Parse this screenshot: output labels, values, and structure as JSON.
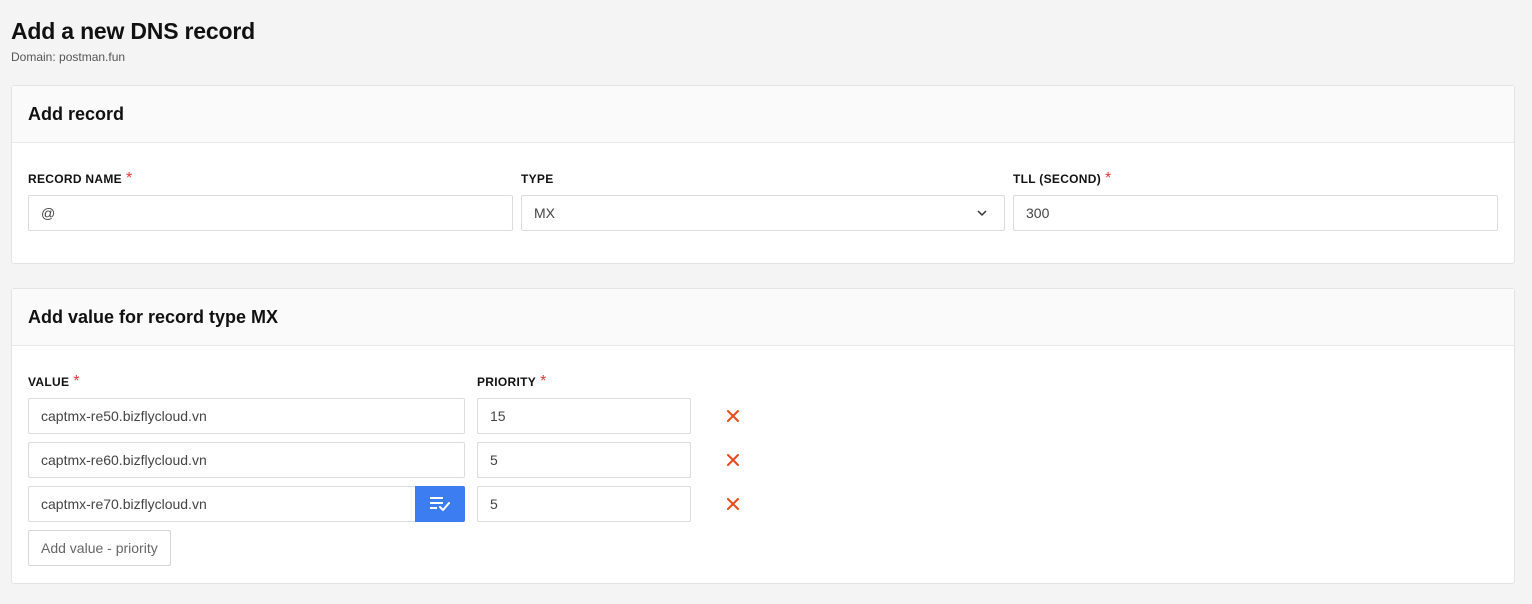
{
  "header": {
    "title": "Add a new DNS record",
    "subtitle": "Domain: postman.fun"
  },
  "record_card": {
    "title": "Add record",
    "name_label": "RECORD NAME",
    "name_value": "@",
    "type_label": "TYPE",
    "type_value": "MX",
    "ttl_label": "TLL (SECOND)",
    "ttl_value": "300",
    "required_mark": "*"
  },
  "value_card": {
    "title": "Add value for record type MX",
    "value_label": "VALUE",
    "priority_label": "PRIORITY",
    "rows": [
      {
        "value": "captmx-re50.bizflycloud.vn",
        "priority": "15"
      },
      {
        "value": "captmx-re60.bizflycloud.vn",
        "priority": "5"
      },
      {
        "value": "captmx-re70.bizflycloud.vn",
        "priority": "5"
      }
    ],
    "add_button_label": "Add value - priority"
  },
  "colors": {
    "accent": "#3d7df2",
    "delete": "#e64a19",
    "required": "#e53935"
  },
  "icons": {
    "type_select": "chevron-down-icon",
    "delete": "close-icon",
    "apply": "playlist-check-icon"
  }
}
